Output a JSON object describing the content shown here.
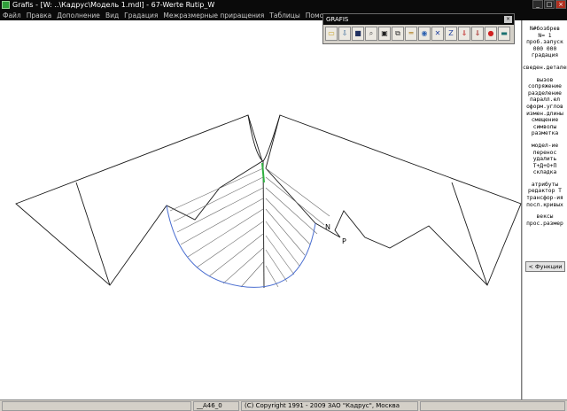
{
  "window": {
    "title": "Grafis - [W: ..\\Кадрус\\Модель 1.mdl] - 67-Werte Rutip_W",
    "controls": [
      "_",
      "□",
      "×"
    ]
  },
  "menu": [
    "Файл",
    "Правка",
    "Дополнение",
    "Вид",
    "Градация",
    "Межразмерные приращения",
    "Таблицы",
    "Помощь"
  ],
  "toolbar": {
    "title": "GRAFIS",
    "close": "×",
    "buttons": [
      {
        "name": "open-folder-icon",
        "glyph": "▭",
        "color": "#c8a020"
      },
      {
        "name": "import-icon",
        "glyph": "⇩",
        "color": "#3a6a9a"
      },
      {
        "name": "save-icon",
        "glyph": "■",
        "color": "#203060"
      },
      {
        "name": "zoom-icon",
        "glyph": "⌕",
        "color": "#404040"
      },
      {
        "name": "window-icon",
        "glyph": "▣",
        "color": "#202020"
      },
      {
        "name": "frame-icon",
        "glyph": "⧉",
        "color": "#303030"
      },
      {
        "name": "ruler-icon",
        "glyph": "═",
        "color": "#b08020"
      },
      {
        "name": "globe-icon",
        "glyph": "◉",
        "color": "#2a60b0"
      },
      {
        "name": "cross-tool-icon",
        "glyph": "✕",
        "color": "#2040a0"
      },
      {
        "name": "z-tool-icon",
        "glyph": "Z",
        "color": "#2040a0"
      },
      {
        "name": "download-red-icon",
        "glyph": "⇓",
        "color": "#c02020"
      },
      {
        "name": "download-red-2-icon",
        "glyph": "⇓",
        "color": "#a02020"
      },
      {
        "name": "stop-icon",
        "glyph": "●",
        "color": "#d02020"
      },
      {
        "name": "exit-icon",
        "glyph": "▬",
        "color": "#1a7070"
      }
    ]
  },
  "panel": {
    "groups": [
      [
        "N#бозбрев",
        "N=  1",
        "проб.запуск",
        "000 000",
        "градация"
      ],
      [
        "сведен.деталей"
      ],
      [
        "вызов",
        "сопряжение",
        "разделение",
        "паралл.ел",
        "оформ.углов",
        "измен.длины",
        "смещение",
        "символы",
        "разметка"
      ],
      [
        "модел-ие",
        "перенос",
        "удалить",
        "Т+Д+О+П",
        "складка"
      ],
      [
        "атрибуты",
        "редактор Т",
        "трансфор-ия",
        "посл.кривых"
      ],
      [
        "вексы",
        "прос.размер"
      ]
    ],
    "functions_button": "< Функции"
  },
  "canvas": {
    "labels": {
      "n": "N",
      "p": "P"
    }
  },
  "status": {
    "cell1": "",
    "cell2": "__A46_0",
    "cell3": "(C) Copyright 1991 - 2009 ЗАО \"Кадрус\", Москва",
    "cell4": ""
  },
  "colors": {
    "bar": "#0a0a0a",
    "curve_blue": "#4a6ed0",
    "green_mark": "#30b040",
    "toolbar_bg": "#d4d0c8"
  }
}
